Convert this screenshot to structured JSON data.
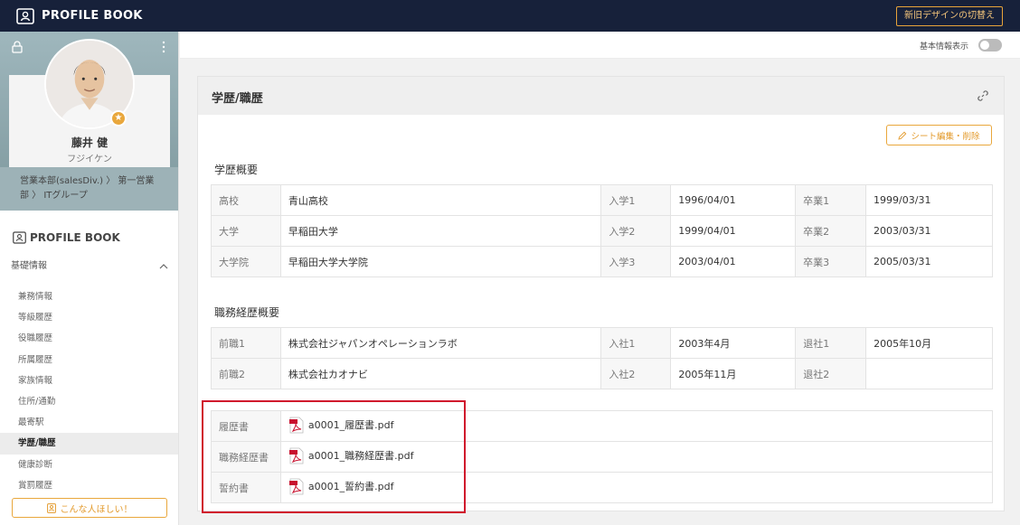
{
  "header": {
    "brand": "PROFILE BOOK",
    "switch_design": "新旧デザインの切替え"
  },
  "profile": {
    "name": "藤井 健",
    "kana": "フジイケン",
    "dept_line1": "営業本部(salesDiv.) 〉 第一営業",
    "dept_line2": "部 〉 ITグループ"
  },
  "sidebar": {
    "brand": "PROFILE BOOK",
    "section": "基礎情報",
    "items": [
      {
        "label": "兼務情報"
      },
      {
        "label": "等級履歴"
      },
      {
        "label": "役職履歴"
      },
      {
        "label": "所属履歴"
      },
      {
        "label": "家族情報"
      },
      {
        "label": "住所/通勤"
      },
      {
        "label": "最寄駅"
      },
      {
        "label": "学歴/職歴",
        "active": true
      },
      {
        "label": "健康診断"
      },
      {
        "label": "賞罰履歴"
      }
    ],
    "wish_button": "こんな人ほしい！"
  },
  "topbar_main": {
    "toggle_label": "基本情報表示",
    "toggle_on": false
  },
  "card": {
    "title": "学歴/職歴",
    "edit_button": "シート編集・削除",
    "education": {
      "heading": "学歴概要",
      "rows": [
        {
          "type": "高校",
          "school": "青山高校",
          "in_label": "入学1",
          "in_date": "1996/04/01",
          "out_label": "卒業1",
          "out_date": "1999/03/31"
        },
        {
          "type": "大学",
          "school": "早稲田大学",
          "in_label": "入学2",
          "in_date": "1999/04/01",
          "out_label": "卒業2",
          "out_date": "2003/03/31"
        },
        {
          "type": "大学院",
          "school": "早稲田大学大学院",
          "in_label": "入学3",
          "in_date": "2003/04/01",
          "out_label": "卒業3",
          "out_date": "2005/03/31"
        }
      ]
    },
    "career": {
      "heading": "職務経歴概要",
      "rows": [
        {
          "type": "前職1",
          "company": "株式会社ジャパンオペレーションラボ",
          "in_label": "入社1",
          "in_date": "2003年4月",
          "out_label": "退社1",
          "out_date": "2005年10月"
        },
        {
          "type": "前職2",
          "company": "株式会社カオナビ",
          "in_label": "入社2",
          "in_date": "2005年11月",
          "out_label": "退社2",
          "out_date": ""
        }
      ]
    },
    "files": [
      {
        "label": "履歴書",
        "file": "a0001_履歴書.pdf"
      },
      {
        "label": "職務経歴書",
        "file": "a0001_職務経歴書.pdf"
      },
      {
        "label": "誓約書",
        "file": "a0001_誓約書.pdf"
      }
    ]
  },
  "colors": {
    "header_bg": "#17213a",
    "accent": "#e9a73c",
    "highlight": "#d0142c"
  }
}
